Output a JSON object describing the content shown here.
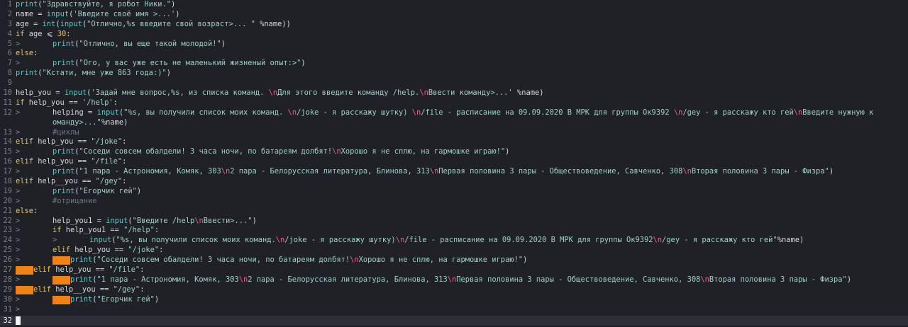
{
  "editor": {
    "lines": [
      {
        "n": "1",
        "indent": 0,
        "marker": "",
        "tokens": [
          [
            "fn",
            "print"
          ],
          [
            "op",
            "("
          ],
          [
            "str",
            "\"Здравствуйте, я робот Ники.\""
          ],
          [
            "op",
            ")"
          ]
        ]
      },
      {
        "n": "2",
        "indent": 0,
        "marker": "",
        "tokens": [
          [
            "id",
            "name "
          ],
          [
            "op",
            "= "
          ],
          [
            "fn",
            "input"
          ],
          [
            "op",
            "("
          ],
          [
            "str",
            "'Введите своё имя >...'"
          ],
          [
            "op",
            ")"
          ]
        ]
      },
      {
        "n": "3",
        "indent": 0,
        "marker": "",
        "tokens": [
          [
            "id",
            "age "
          ],
          [
            "op",
            "= "
          ],
          [
            "fn",
            "int"
          ],
          [
            "op",
            "("
          ],
          [
            "fn",
            "input"
          ],
          [
            "op",
            "("
          ],
          [
            "str",
            "\"Отлично,%s введите свой возраст>... \""
          ],
          [
            "op",
            " %name))"
          ]
        ]
      },
      {
        "n": "4",
        "indent": 0,
        "marker": "",
        "tokens": [
          [
            "kw",
            "if"
          ],
          [
            "id",
            " age "
          ],
          [
            "op",
            "⩽ "
          ],
          [
            "num",
            "30"
          ],
          [
            "op",
            ":"
          ]
        ]
      },
      {
        "n": "5",
        "indent": 1,
        "marker": ">",
        "tokens": [
          [
            "fn",
            "print"
          ],
          [
            "op",
            "("
          ],
          [
            "str",
            "\"Отлично, вы еще такой молодой!\""
          ],
          [
            "op",
            ")"
          ]
        ]
      },
      {
        "n": "6",
        "indent": 0,
        "marker": "",
        "tokens": [
          [
            "kw",
            "else"
          ],
          [
            "op",
            ":"
          ]
        ]
      },
      {
        "n": "7",
        "indent": 1,
        "marker": ">",
        "tokens": [
          [
            "fn",
            "print"
          ],
          [
            "op",
            "("
          ],
          [
            "str",
            "\"Ого, у вас уже есть не маленький жизненый опыт:>\""
          ],
          [
            "op",
            ")"
          ]
        ]
      },
      {
        "n": "8",
        "indent": 0,
        "marker": "",
        "tokens": [
          [
            "fn",
            "print"
          ],
          [
            "op",
            "("
          ],
          [
            "str",
            "\"Кстати, мне уже 863 года:)\""
          ],
          [
            "op",
            ")"
          ]
        ]
      },
      {
        "n": "9",
        "indent": 0,
        "marker": "",
        "tokens": []
      },
      {
        "n": "10",
        "indent": 0,
        "marker": "",
        "tokens": [
          [
            "id",
            "help_you "
          ],
          [
            "op",
            "= "
          ],
          [
            "fn",
            "input"
          ],
          [
            "op",
            "("
          ],
          [
            "str",
            "'Задай мне вопрос,%s, из списка команд. "
          ],
          [
            "esc",
            "\\n"
          ],
          [
            "str",
            "Для этого введите команду /help."
          ],
          [
            "esc",
            "\\n"
          ],
          [
            "str",
            "Ввести команду>...'"
          ],
          [
            "op",
            " %name)"
          ]
        ]
      },
      {
        "n": "11",
        "indent": 0,
        "marker": "",
        "tokens": [
          [
            "kw",
            "if"
          ],
          [
            "id",
            " help_you "
          ],
          [
            "op",
            "== "
          ],
          [
            "str",
            "'/help'"
          ],
          [
            "op",
            ":"
          ]
        ]
      },
      {
        "n": "12",
        "indent": 1,
        "marker": ">",
        "tokens": [
          [
            "id",
            "helping "
          ],
          [
            "op",
            "= "
          ],
          [
            "fn",
            "input"
          ],
          [
            "op",
            "("
          ],
          [
            "str",
            "\"%s, вы получили список моих команд. "
          ],
          [
            "esc",
            "\\n"
          ],
          [
            "str",
            "/joke - я расскажу шутку) "
          ],
          [
            "esc",
            "\\n"
          ],
          [
            "str",
            "/file - расписание на 09.09.2020 В МРК для группы Ок9392 "
          ],
          [
            "esc",
            "\\n"
          ],
          [
            "str",
            "/gey - я расскажу кто гей"
          ],
          [
            "esc",
            "\\n"
          ],
          [
            "str",
            "Введите нужную к"
          ]
        ]
      },
      {
        "n": "",
        "indent": 1,
        "marker": "",
        "tokens": [
          [
            "str",
            "оманду>...\""
          ],
          [
            "op",
            "%name)"
          ]
        ]
      },
      {
        "n": "13",
        "indent": 1,
        "marker": ">",
        "tokens": [
          [
            "cm",
            "#циклы"
          ]
        ]
      },
      {
        "n": "14",
        "indent": 0,
        "marker": "",
        "tokens": [
          [
            "kw",
            "elif"
          ],
          [
            "id",
            " help_you "
          ],
          [
            "op",
            "== "
          ],
          [
            "str",
            "\"/joke\""
          ],
          [
            "op",
            ":"
          ]
        ]
      },
      {
        "n": "15",
        "indent": 1,
        "marker": ">",
        "tokens": [
          [
            "fn",
            "print"
          ],
          [
            "op",
            "("
          ],
          [
            "str",
            "\"Соседи совсем обалдели! 3 часа ночи, по батареям долбят!"
          ],
          [
            "esc",
            "\\n"
          ],
          [
            "str",
            "Хорошо я не сплю, на гармошке играю!\""
          ],
          [
            "op",
            ")"
          ]
        ]
      },
      {
        "n": "16",
        "indent": 0,
        "marker": "",
        "tokens": [
          [
            "kw",
            "elif"
          ],
          [
            "id",
            " help_you "
          ],
          [
            "op",
            "== "
          ],
          [
            "str",
            "\"/file\""
          ],
          [
            "op",
            ":"
          ]
        ]
      },
      {
        "n": "17",
        "indent": 1,
        "marker": ">",
        "tokens": [
          [
            "fn",
            "print"
          ],
          [
            "op",
            "("
          ],
          [
            "str",
            "\"1 пара - Астрономия, Комяк, 303"
          ],
          [
            "esc",
            "\\n"
          ],
          [
            "str",
            "2 пара - Белорусская литература, Блинова, 313"
          ],
          [
            "esc",
            "\\n"
          ],
          [
            "str",
            "Первая половина 3 пары - Обществоведение, Савченко, 308"
          ],
          [
            "esc",
            "\\n"
          ],
          [
            "str",
            "Вторая половина 3 пары - Физра\""
          ],
          [
            "op",
            ")"
          ]
        ]
      },
      {
        "n": "18",
        "indent": 0,
        "marker": "",
        "tokens": [
          [
            "kw",
            "elif"
          ],
          [
            "id",
            " help__you "
          ],
          [
            "op",
            "== "
          ],
          [
            "str",
            "\"/gey\""
          ],
          [
            "op",
            ":"
          ]
        ]
      },
      {
        "n": "19",
        "indent": 1,
        "marker": ">",
        "tokens": [
          [
            "fn",
            "print"
          ],
          [
            "op",
            "("
          ],
          [
            "str",
            "\"Егорчик гей\""
          ],
          [
            "op",
            ")"
          ]
        ]
      },
      {
        "n": "20",
        "indent": 1,
        "marker": ">",
        "tokens": [
          [
            "cm",
            "#отрицание"
          ]
        ]
      },
      {
        "n": "21",
        "indent": 0,
        "marker": "",
        "tokens": [
          [
            "kw",
            "else"
          ],
          [
            "op",
            ":"
          ]
        ]
      },
      {
        "n": "22",
        "indent": 1,
        "marker": ">",
        "tokens": [
          [
            "id",
            "help_you1 "
          ],
          [
            "op",
            "= "
          ],
          [
            "fn",
            "input"
          ],
          [
            "op",
            "("
          ],
          [
            "str",
            "\"Введите /help"
          ],
          [
            "esc",
            "\\n"
          ],
          [
            "str",
            "Ввести>...\""
          ],
          [
            "op",
            ")"
          ]
        ]
      },
      {
        "n": "23",
        "indent": 1,
        "marker": ">",
        "tokens": [
          [
            "kw",
            "if"
          ],
          [
            "id",
            " help_you1 "
          ],
          [
            "op",
            "== "
          ],
          [
            "str",
            "\"/help\""
          ],
          [
            "op",
            ":"
          ]
        ]
      },
      {
        "n": "24",
        "indent": 1,
        "marker": ">",
        "marker2": ">",
        "tokens": [
          [
            "fn",
            "input"
          ],
          [
            "op",
            "("
          ],
          [
            "str",
            "\"%s, вы получили список моих команд."
          ],
          [
            "esc",
            "\\n"
          ],
          [
            "str",
            "/joke - я расскажу шутку)"
          ],
          [
            "esc",
            "\\n"
          ],
          [
            "str",
            "/file - расписание на 09.09.2020 В МРК для группы Ок9392"
          ],
          [
            "esc",
            "\\n"
          ],
          [
            "str",
            "/gey - я расскажу кто гей\""
          ],
          [
            "op",
            "%name)"
          ]
        ]
      },
      {
        "n": "25",
        "indent": 1,
        "marker": ">",
        "tokens": [
          [
            "kw",
            "elif"
          ],
          [
            "id",
            " help_you "
          ],
          [
            "op",
            "== "
          ],
          [
            "str",
            "\"/joke\""
          ],
          [
            "op",
            ":"
          ]
        ]
      },
      {
        "n": "26",
        "indent": 1,
        "marker": ">",
        "hl": "a",
        "tokens": [
          [
            "fn",
            "print"
          ],
          [
            "op",
            "("
          ],
          [
            "str",
            "\"Соседи совсем обалдели! 3 часа ночи, по батареям долбят!"
          ],
          [
            "esc",
            "\\n"
          ],
          [
            "str",
            "Хорошо я не сплю, на гармошке играю!\""
          ],
          [
            "op",
            ")"
          ]
        ]
      },
      {
        "n": "27",
        "indent": 0,
        "marker": "",
        "hl": "b",
        "tokens": [
          [
            "kw",
            "elif"
          ],
          [
            "id",
            " help_you "
          ],
          [
            "op",
            "== "
          ],
          [
            "str",
            "\"/file\""
          ],
          [
            "op",
            ":"
          ]
        ]
      },
      {
        "n": "28",
        "indent": 1,
        "marker": ">",
        "hl": "a",
        "tokens": [
          [
            "fn",
            "print"
          ],
          [
            "op",
            "("
          ],
          [
            "str",
            "\"1 пара - Астрономия, Комяк, 303"
          ],
          [
            "esc",
            "\\n"
          ],
          [
            "str",
            "2 пара - Белорусская литература, Блинова, 313"
          ],
          [
            "esc",
            "\\n"
          ],
          [
            "str",
            "Первая половина 3 пары - Обществоведение, Савченко, 308"
          ],
          [
            "esc",
            "\\n"
          ],
          [
            "str",
            "Вторая половина 3 пары - Физра\""
          ],
          [
            "op",
            ")"
          ]
        ]
      },
      {
        "n": "29",
        "indent": 0,
        "marker": "",
        "hl": "b",
        "tokens": [
          [
            "kw",
            "elif"
          ],
          [
            "id",
            " help__you "
          ],
          [
            "op",
            "== "
          ],
          [
            "str",
            "\"/gey\""
          ],
          [
            "op",
            ":"
          ]
        ]
      },
      {
        "n": "30",
        "indent": 1,
        "marker": ">",
        "hl": "a",
        "tokens": [
          [
            "fn",
            "print"
          ],
          [
            "op",
            "("
          ],
          [
            "str",
            "\"Егорчик гей\""
          ],
          [
            "op",
            ")"
          ]
        ]
      },
      {
        "n": "31",
        "indent": 0,
        "marker": ">",
        "tokens": []
      }
    ]
  },
  "statusline": {
    "line_number": "32"
  }
}
